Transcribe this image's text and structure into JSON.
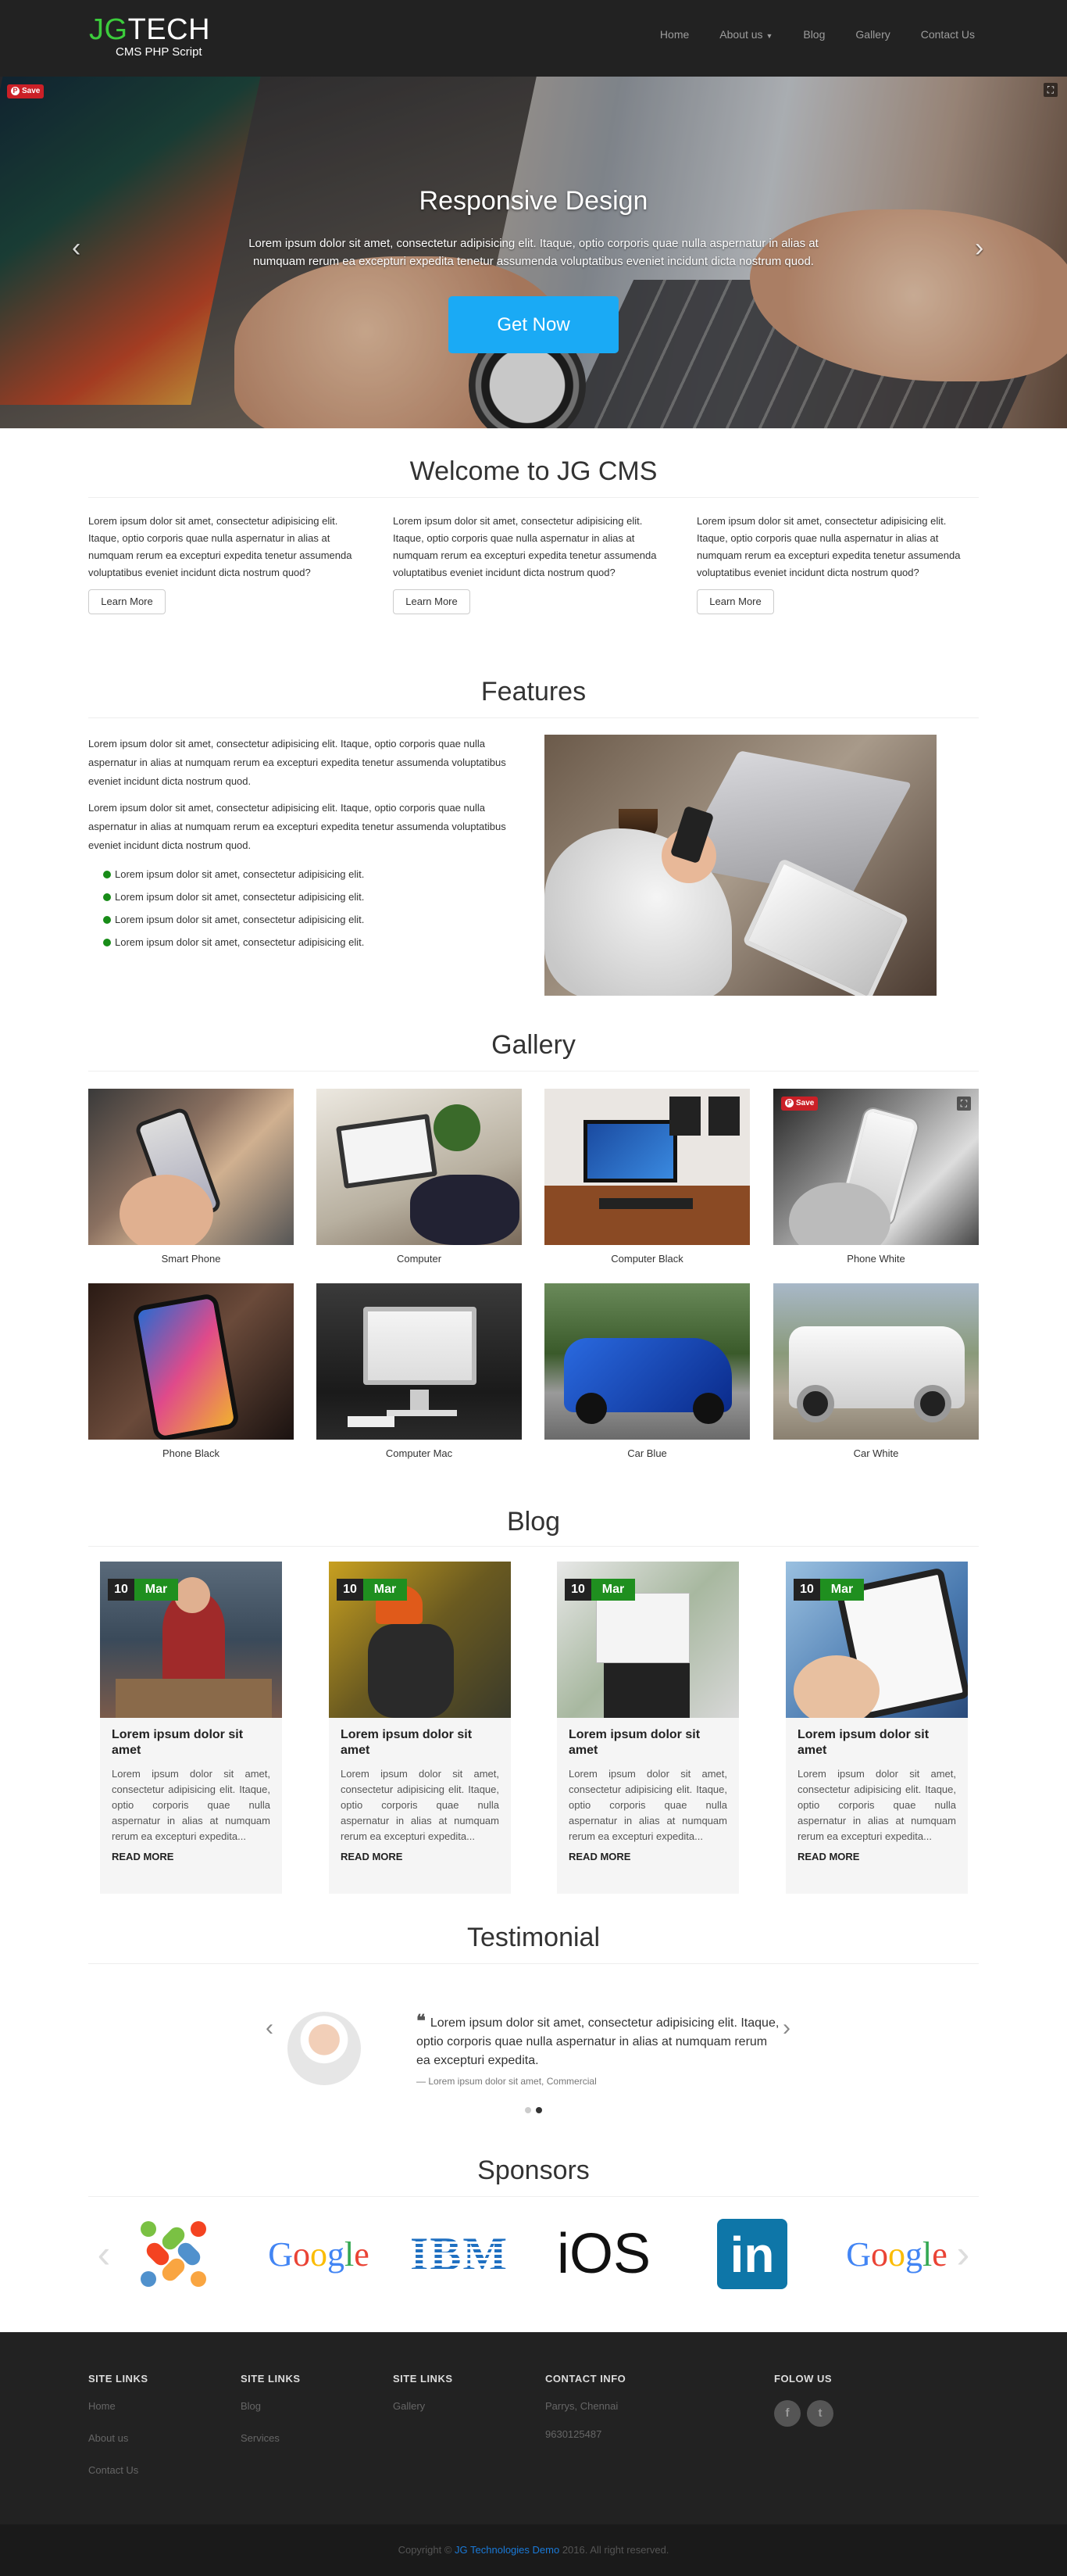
{
  "nav": {
    "logo_jg": "JG",
    "logo_tech": "TECH",
    "logo_sub": "CMS PHP Script",
    "items": [
      "Home",
      "About us",
      "Blog",
      "Gallery",
      "Contact Us"
    ]
  },
  "hero": {
    "title": "Responsive Design",
    "text": "Lorem ipsum dolor sit amet, consectetur adipisicing elit. Itaque, optio corporis quae nulla aspernatur in alias at numquam rerum ea excepturi expedita tenetur assumenda voluptatibus eveniet incidunt dicta nostrum quod.",
    "button": "Get Now",
    "save": "Save"
  },
  "welcome": {
    "title": "Welcome to JG CMS",
    "columns": [
      {
        "text": "Lorem ipsum dolor sit amet, consectetur adipisicing elit. Itaque, optio corporis quae nulla aspernatur in alias at numquam rerum ea excepturi expedita tenetur assumenda voluptatibus eveniet incidunt dicta nostrum quod?",
        "button": "Learn More"
      },
      {
        "text": "Lorem ipsum dolor sit amet, consectetur adipisicing elit. Itaque, optio corporis quae nulla aspernatur in alias at numquam rerum ea excepturi expedita tenetur assumenda voluptatibus eveniet incidunt dicta nostrum quod?",
        "button": "Learn More"
      },
      {
        "text": "Lorem ipsum dolor sit amet, consectetur adipisicing elit. Itaque, optio corporis quae nulla aspernatur in alias at numquam rerum ea excepturi expedita tenetur assumenda voluptatibus eveniet incidunt dicta nostrum quod?",
        "button": "Learn More"
      }
    ]
  },
  "features": {
    "title": "Features",
    "p1": "Lorem ipsum dolor sit amet, consectetur adipisicing elit. Itaque, optio corporis quae nulla aspernatur in alias at numquam rerum ea excepturi expedita tenetur assumenda voluptatibus eveniet incidunt dicta nostrum quod.",
    "p2": "Lorem ipsum dolor sit amet, consectetur adipisicing elit. Itaque, optio corporis quae nulla aspernatur in alias at numquam rerum ea excepturi expedita tenetur assumenda voluptatibus eveniet incidunt dicta nostrum quod.",
    "bullets": [
      "Lorem ipsum dolor sit amet, consectetur adipisicing elit.",
      "Lorem ipsum dolor sit amet, consectetur adipisicing elit.",
      "Lorem ipsum dolor sit amet, consectetur adipisicing elit.",
      "Lorem ipsum dolor sit amet, consectetur adipisicing elit."
    ]
  },
  "gallery": {
    "title": "Gallery",
    "save": "Save",
    "items": [
      "Smart Phone",
      "Computer",
      "Computer Black",
      "Phone White",
      "Phone Black",
      "Computer Mac",
      "Car Blue",
      "Car White"
    ]
  },
  "blog": {
    "title": "Blog",
    "posts": [
      {
        "day": "10",
        "month": "Mar",
        "title": "Lorem ipsum dolor sit amet",
        "text": "Lorem ipsum dolor sit amet, consectetur adipisicing elit. Itaque, optio corporis quae nulla aspernatur in alias at numquam rerum ea excepturi expedita...",
        "more": "READ MORE"
      },
      {
        "day": "10",
        "month": "Mar",
        "title": "Lorem ipsum dolor sit amet",
        "text": "Lorem ipsum dolor sit amet, consectetur adipisicing elit. Itaque, optio corporis quae nulla aspernatur in alias at numquam rerum ea excepturi expedita...",
        "more": "READ MORE"
      },
      {
        "day": "10",
        "month": "Mar",
        "title": "Lorem ipsum dolor sit amet",
        "text": "Lorem ipsum dolor sit amet, consectetur adipisicing elit. Itaque, optio corporis quae nulla aspernatur in alias at numquam rerum ea excepturi expedita...",
        "more": "READ MORE"
      },
      {
        "day": "10",
        "month": "Mar",
        "title": "Lorem ipsum dolor sit amet",
        "text": "Lorem ipsum dolor sit amet, consectetur adipisicing elit. Itaque, optio corporis quae nulla aspernatur in alias at numquam rerum ea excepturi expedita...",
        "more": "READ MORE"
      }
    ]
  },
  "testimonial": {
    "title": "Testimonial",
    "quote": "Lorem ipsum dolor sit amet, consectetur adipisicing elit. Itaque, optio corporis quae nulla aspernatur in alias at numquam rerum ea excepturi expedita.",
    "author": "— Lorem ipsum dolor sit amet, Commercial"
  },
  "sponsors": {
    "title": "Sponsors",
    "logos": [
      "Joomla",
      "Google",
      "IBM",
      "iOS",
      "in",
      "Google"
    ]
  },
  "footer": {
    "col1": {
      "title": "SITE LINKS",
      "links": [
        "Home",
        "About us",
        "Contact Us"
      ]
    },
    "col2": {
      "title": "SITE LINKS",
      "links": [
        "Blog",
        "Services"
      ]
    },
    "col3": {
      "title": "SITE LINKS",
      "links": [
        "Gallery"
      ]
    },
    "contact": {
      "title": "CONTACT INFO",
      "address": "Parrys, Chennai",
      "phone": "9630125487"
    },
    "follow": {
      "title": "FOLOW US",
      "icons": [
        "f",
        "t"
      ]
    },
    "copy_pre": "Copyright ©",
    "copy_link": "JG Technologies Demo",
    "copy_post": "2016. All right reserved."
  },
  "colors": {
    "accent_green": "#1f8f1f",
    "hero_button": "#1aaaf5",
    "dark": "#222222"
  }
}
